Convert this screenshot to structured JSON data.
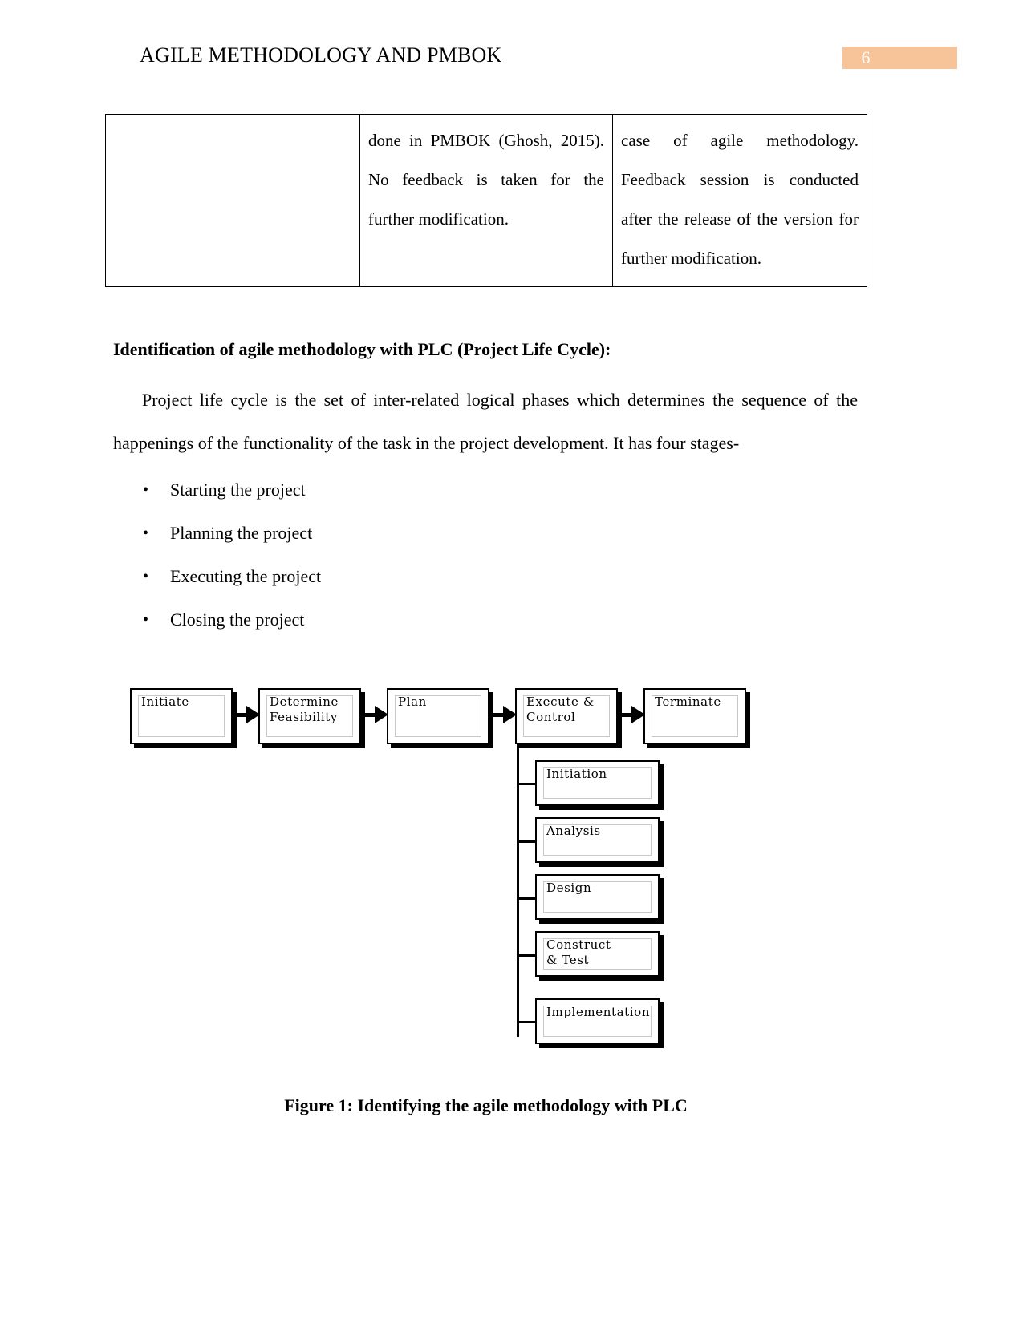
{
  "header": {
    "title": "AGILE METHODOLOGY AND PMBOK",
    "page_number": "6",
    "page_number_bg": "#f7c49a",
    "page_number_color": "#ffffff"
  },
  "table": {
    "rows": [
      {
        "cells": [
          "",
          "done in PMBOK (Ghosh, 2015). No feedback is taken for the further modification.",
          "case of agile methodology. Feedback session is conducted after the release of the version for further modification."
        ]
      }
    ]
  },
  "content": {
    "heading": "Identification of agile methodology with PLC (Project Life Cycle):",
    "paragraph": "Project life cycle is the set of inter-related logical phases which determines the sequence of the happenings of the functionality of the task in the project development. It has four stages-",
    "bullet_glyph": "•",
    "bullets": [
      "Starting the project",
      "Planning  the project",
      "Executing the project",
      "Closing  the project"
    ]
  },
  "figure": {
    "caption": "Figure 1: Identifying the agile methodology with PLC",
    "flow_boxes": [
      {
        "label": "Initiate"
      },
      {
        "label": "Determine\nFeasibility"
      },
      {
        "label": "Plan"
      },
      {
        "label": "Execute &\nControl"
      },
      {
        "label": "Terminate"
      }
    ],
    "sub_boxes": [
      {
        "label": "Initiation"
      },
      {
        "label": "Analysis"
      },
      {
        "label": "Design"
      },
      {
        "label": "Construct\n& Test"
      },
      {
        "label": "Implementation"
      }
    ]
  }
}
